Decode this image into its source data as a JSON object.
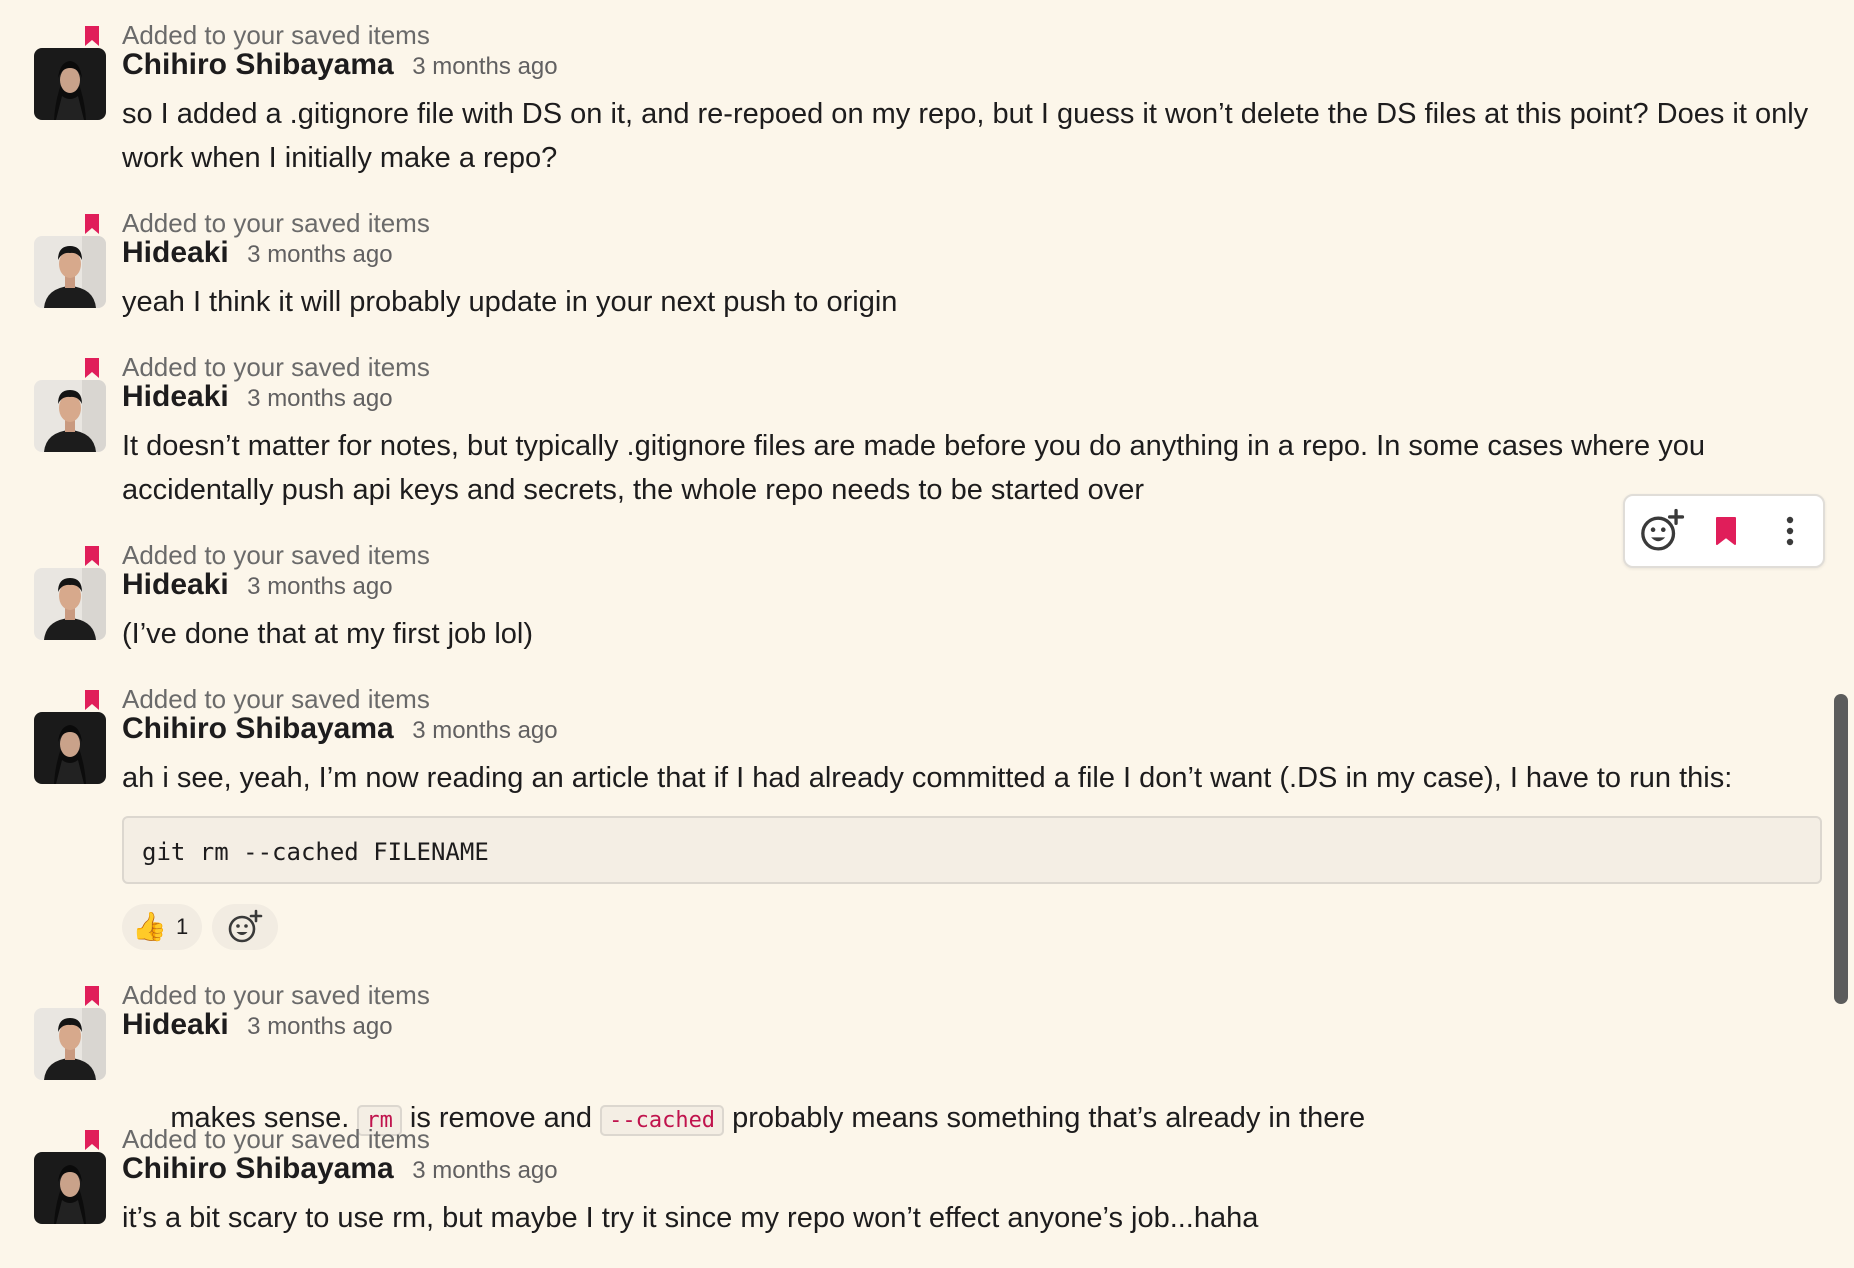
{
  "saved_label": "Added to your saved items",
  "colors": {
    "saved_icon": "#e01e5a",
    "background": "#fcf6ea",
    "inline_code": "#c0134d"
  },
  "messages": [
    {
      "author": "Chihiro Shibayama",
      "time": "3 months ago",
      "text": "so I added a .gitignore file with DS on it, and re-repoed on my repo, but I guess it won’t delete the DS files at this point? Does it only work when I initially make a repo?"
    },
    {
      "author": "Hideaki",
      "time": "3 months ago",
      "text": "yeah I think it will probably update in your next push to origin"
    },
    {
      "author": "Hideaki",
      "time": "3 months ago",
      "text": "It doesn’t matter for notes, but typically .gitignore files are made before you do anything in a repo. In some cases where you accidentally push api keys and secrets, the whole repo needs to be started over"
    },
    {
      "author": "Hideaki",
      "time": "3 months ago",
      "text": "(I’ve done that at my first job lol)"
    },
    {
      "author": "Chihiro Shibayama",
      "time": "3 months ago",
      "text": "ah i see, yeah, I’m now reading an article that if I had already committed a file I don’t want (.DS in my case), I have to run this:",
      "code": "git rm --cached FILENAME",
      "reaction": {
        "emoji": "👍",
        "count": "1"
      }
    },
    {
      "author": "Hideaki",
      "time": "3 months ago",
      "text_pre": "makes sense. ",
      "code1": "rm",
      "text_mid": " is remove and ",
      "code2": "--cached",
      "text_post": " probably means something that’s already in there"
    },
    {
      "author": "Chihiro Shibayama",
      "time": "3 months ago",
      "text": "it’s a bit scary to use rm, but maybe I try it since my repo won’t effect anyone’s job...haha"
    }
  ],
  "toolbar": {
    "icons": [
      "add-reaction-icon",
      "bookmark-icon",
      "more-actions-icon"
    ]
  }
}
